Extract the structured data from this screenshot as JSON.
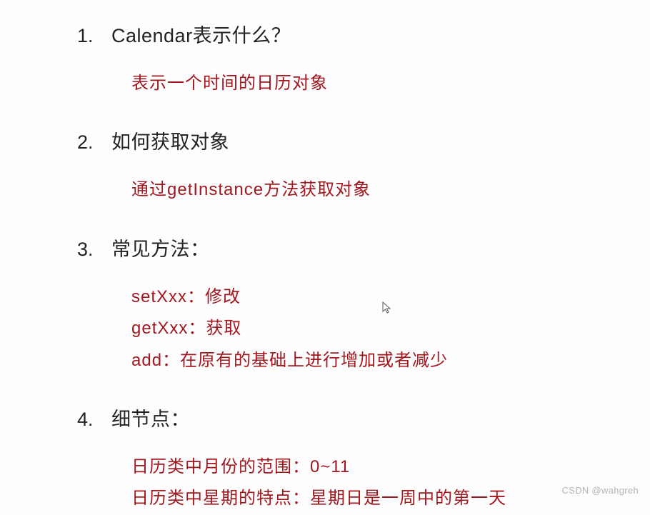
{
  "items": [
    {
      "number": "1.",
      "title": "Calendar表示什么？",
      "answers": [
        "表示一个时间的日历对象"
      ]
    },
    {
      "number": "2.",
      "title": "如何获取对象",
      "answers": [
        "通过getInstance方法获取对象"
      ]
    },
    {
      "number": "3.",
      "title": "常见方法：",
      "answers": [
        "setXxx：修改",
        "getXxx：获取",
        "add：在原有的基础上进行增加或者减少"
      ]
    },
    {
      "number": "4.",
      "title": "细节点：",
      "answers": [
        "日历类中月份的范围：0~11",
        "日历类中星期的特点：星期日是一周中的第一天"
      ]
    }
  ],
  "watermark": "CSDN @wahgreh"
}
